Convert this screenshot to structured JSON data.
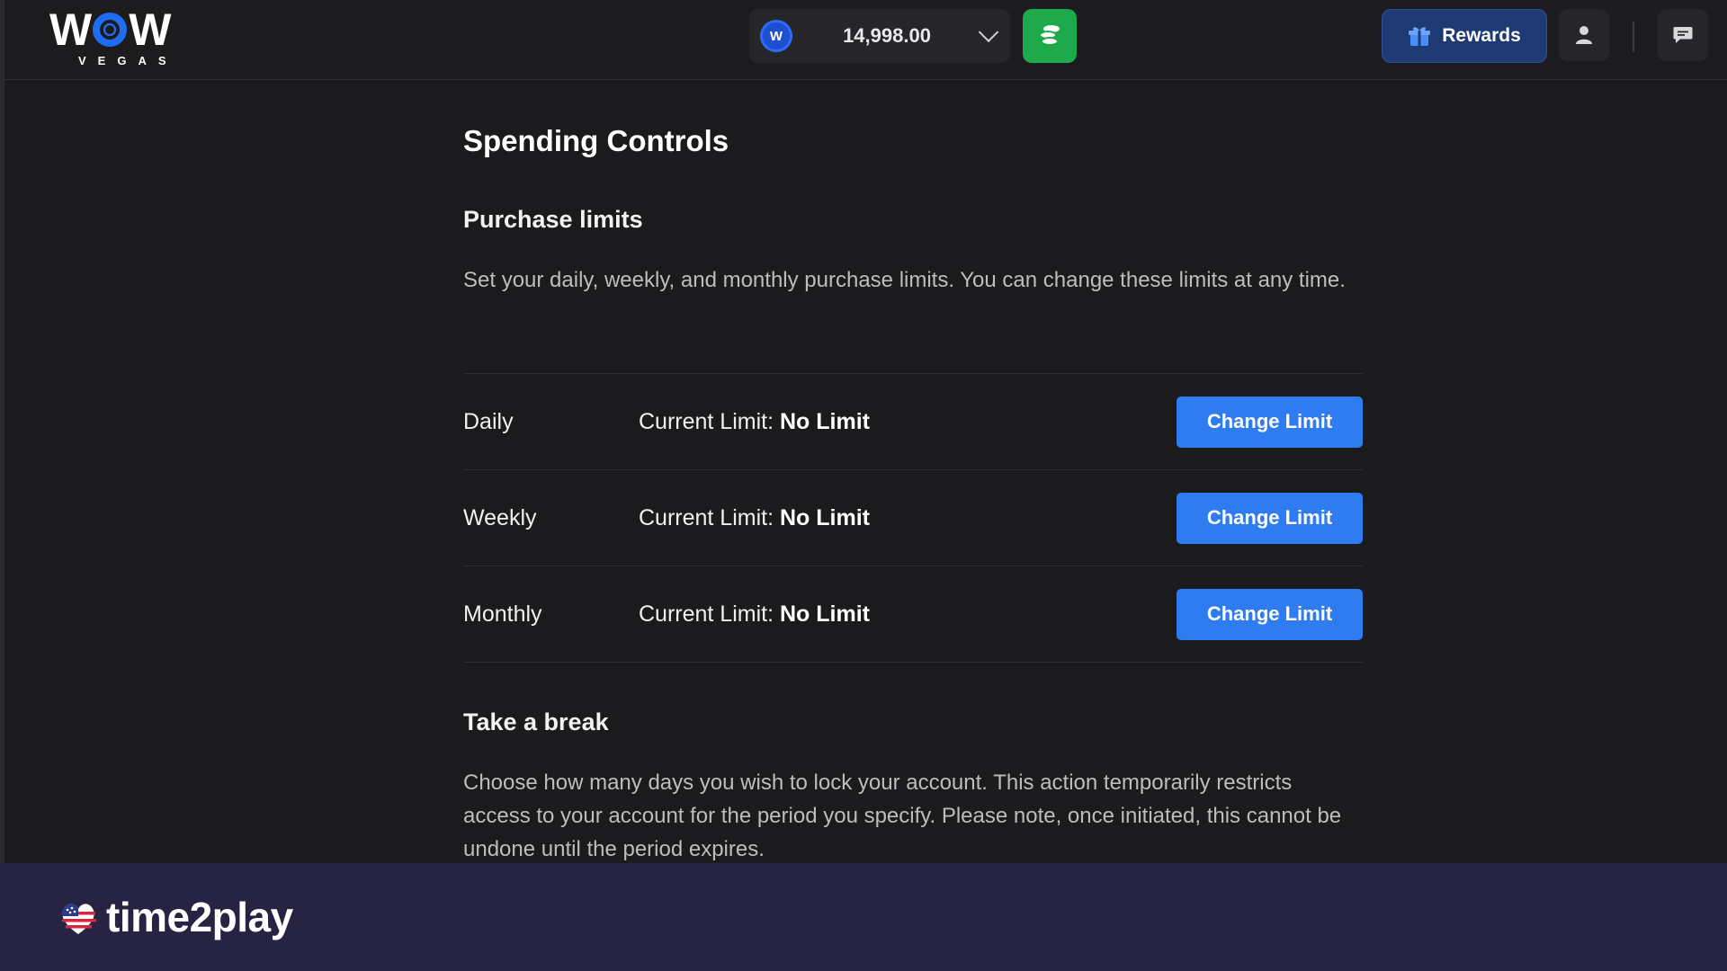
{
  "header": {
    "logo_main": "WOW",
    "logo_sub": "VEGAS",
    "coin_letter": "W",
    "balance": "14,998.00",
    "rewards_label": "Rewards"
  },
  "main": {
    "title": "Spending Controls",
    "purchase_limits": {
      "title": "Purchase limits",
      "description": "Set your daily, weekly, and monthly purchase limits. You can change these limits at any time.",
      "current_prefix": "Current Limit:",
      "rows": [
        {
          "period": "Daily",
          "value": "No Limit",
          "button": "Change Limit"
        },
        {
          "period": "Weekly",
          "value": "No Limit",
          "button": "Change Limit"
        },
        {
          "period": "Monthly",
          "value": "No Limit",
          "button": "Change Limit"
        }
      ]
    },
    "take_a_break": {
      "title": "Take a break",
      "description": "Choose how many days you wish to lock your account. This action temporarily restricts access to your account for the period you specify. Please note, once initiated, this cannot be undone until the period expires."
    }
  },
  "watermark": {
    "brand": "time2play"
  },
  "colors": {
    "accent_blue": "#2f7cf0",
    "buy_green": "#1ea94a",
    "rewards_bg": "#1f3a73",
    "footer_bg": "#272443"
  }
}
